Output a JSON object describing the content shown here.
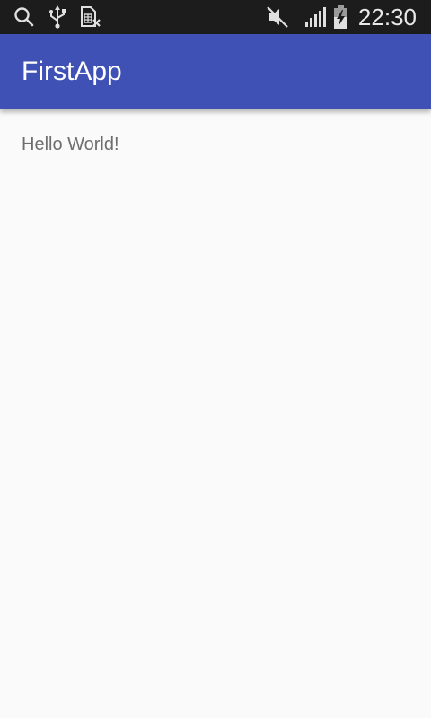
{
  "status_bar": {
    "time": "22:30",
    "icons": [
      "search-icon",
      "usb-icon",
      "no-sim-icon",
      "mute-icon",
      "signal-icon",
      "battery-charging-icon"
    ],
    "background": "#1c1c1c"
  },
  "app_bar": {
    "title": "FirstApp",
    "color": "#3f51b5"
  },
  "content": {
    "text": "Hello World!"
  }
}
